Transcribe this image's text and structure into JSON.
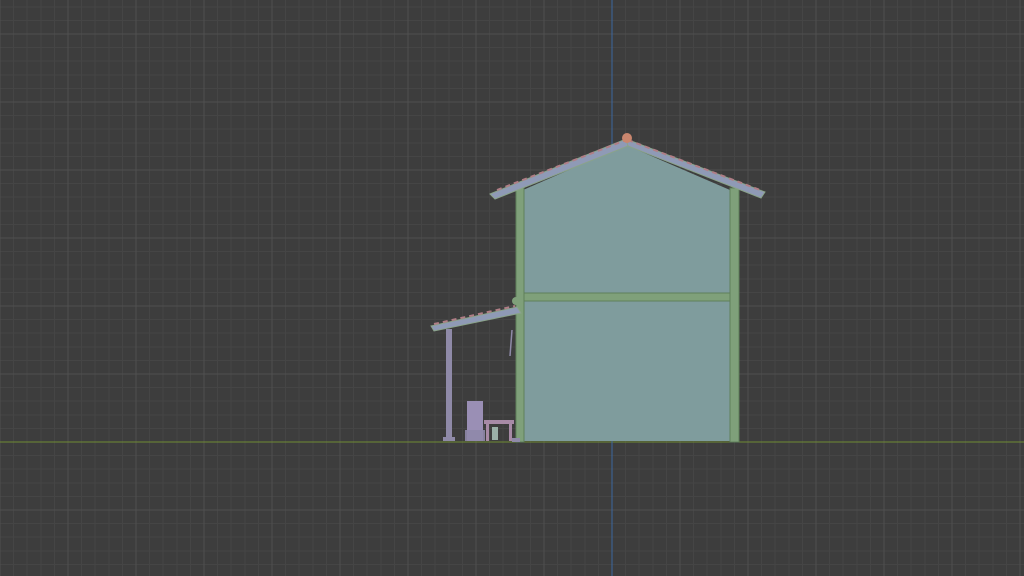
{
  "viewport": {
    "background": "#3d3d3d",
    "grid_minor_color": "#454545",
    "grid_major_color": "#505050",
    "axis_x_color": "#6f8a34",
    "axis_z_color": "#3c66a0"
  },
  "scene": {
    "object": "house-model",
    "view": "orthographic-side",
    "colors": {
      "wall": "#7f9c9d",
      "frame": "#7fa07a",
      "frame_edge": "#5f7f5a",
      "roof_top": "#b07e86",
      "roof_mid": "#8f9ab6",
      "roof_edge": "#8aa38a",
      "post": "#8f8aa8",
      "ridge_cap": "#c9866e",
      "stool": "#9a8fb5",
      "table": "#a78aa6"
    }
  }
}
